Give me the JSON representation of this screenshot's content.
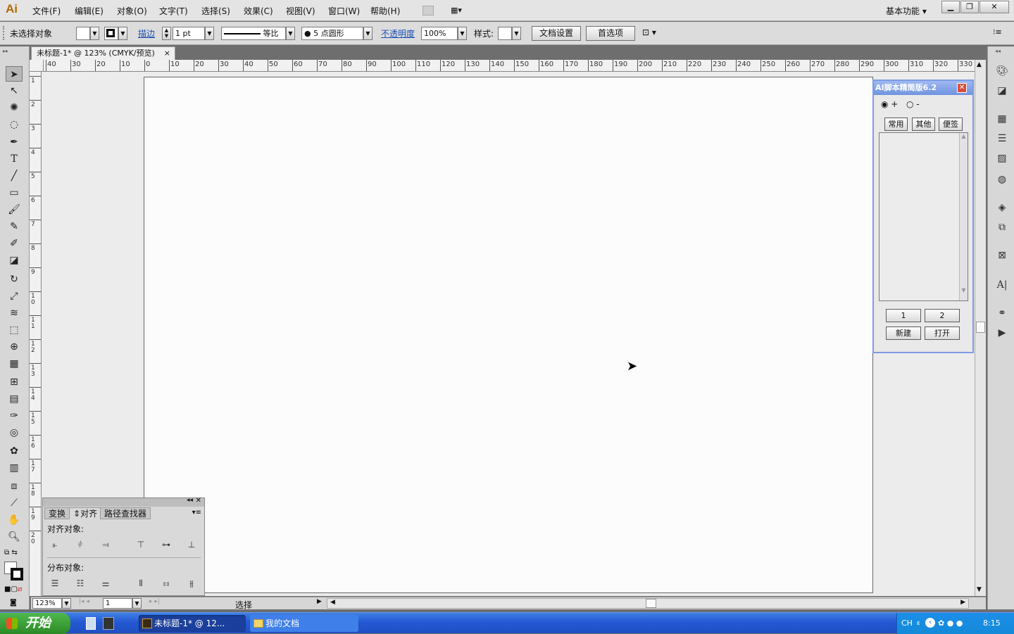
{
  "app": {
    "logo": "Ai"
  },
  "menu": [
    {
      "label": "文件(F)"
    },
    {
      "label": "编辑(E)"
    },
    {
      "label": "对象(O)"
    },
    {
      "label": "文字(T)"
    },
    {
      "label": "选择(S)"
    },
    {
      "label": "效果(C)"
    },
    {
      "label": "视图(V)"
    },
    {
      "label": "窗口(W)"
    },
    {
      "label": "帮助(H)"
    }
  ],
  "workspace": {
    "label": "基本功能"
  },
  "control": {
    "selection_label": "未选择对象",
    "stroke_label": "描边",
    "stroke_weight": "1 pt",
    "stroke_profile": "等比",
    "brush": "5 点圆形",
    "opacity_label": "不透明度",
    "opacity_value": "100%",
    "style_label": "样式:",
    "doc_setup": "文档设置",
    "prefs": "首选项"
  },
  "document": {
    "tab_title": "未标题-1* @ 123% (CMYK/预览)",
    "close": "×"
  },
  "ruler": {
    "h_ticks": [
      "40",
      "30",
      "20",
      "10",
      "0",
      "10",
      "20",
      "30",
      "40",
      "50",
      "60",
      "70",
      "80",
      "90",
      "100",
      "110",
      "120",
      "130",
      "140",
      "150",
      "160",
      "170",
      "180",
      "190",
      "200",
      "210",
      "220",
      "230",
      "240",
      "250",
      "260",
      "270",
      "280",
      "290",
      "300",
      "310",
      "320",
      "330"
    ],
    "v_ticks": [
      "1",
      "2",
      "3",
      "4",
      "5",
      "6",
      "7",
      "8",
      "9",
      "10",
      "11",
      "12",
      "13",
      "14",
      "15",
      "16",
      "17",
      "18",
      "19",
      "20"
    ]
  },
  "script_panel": {
    "title": "AI脚本精简版6.2",
    "radio_plus": "+",
    "radio_minus": "-",
    "tabs": [
      "常用",
      "其他",
      "便签"
    ],
    "page_buttons": [
      "1",
      "2"
    ],
    "new": "新建",
    "open": "打开"
  },
  "align_panel": {
    "tabs": [
      "变换",
      "对齐",
      "路径查找器"
    ],
    "align_objects": "对齐对象:",
    "distribute_objects": "分布对象:"
  },
  "status": {
    "zoom": "123%",
    "page": "1",
    "tool": "选择"
  },
  "taskbar": {
    "start": "开始",
    "tasks": [
      "未标题-1* @ 12...",
      "我的文档"
    ],
    "lang": "CH",
    "time": "8:15"
  }
}
